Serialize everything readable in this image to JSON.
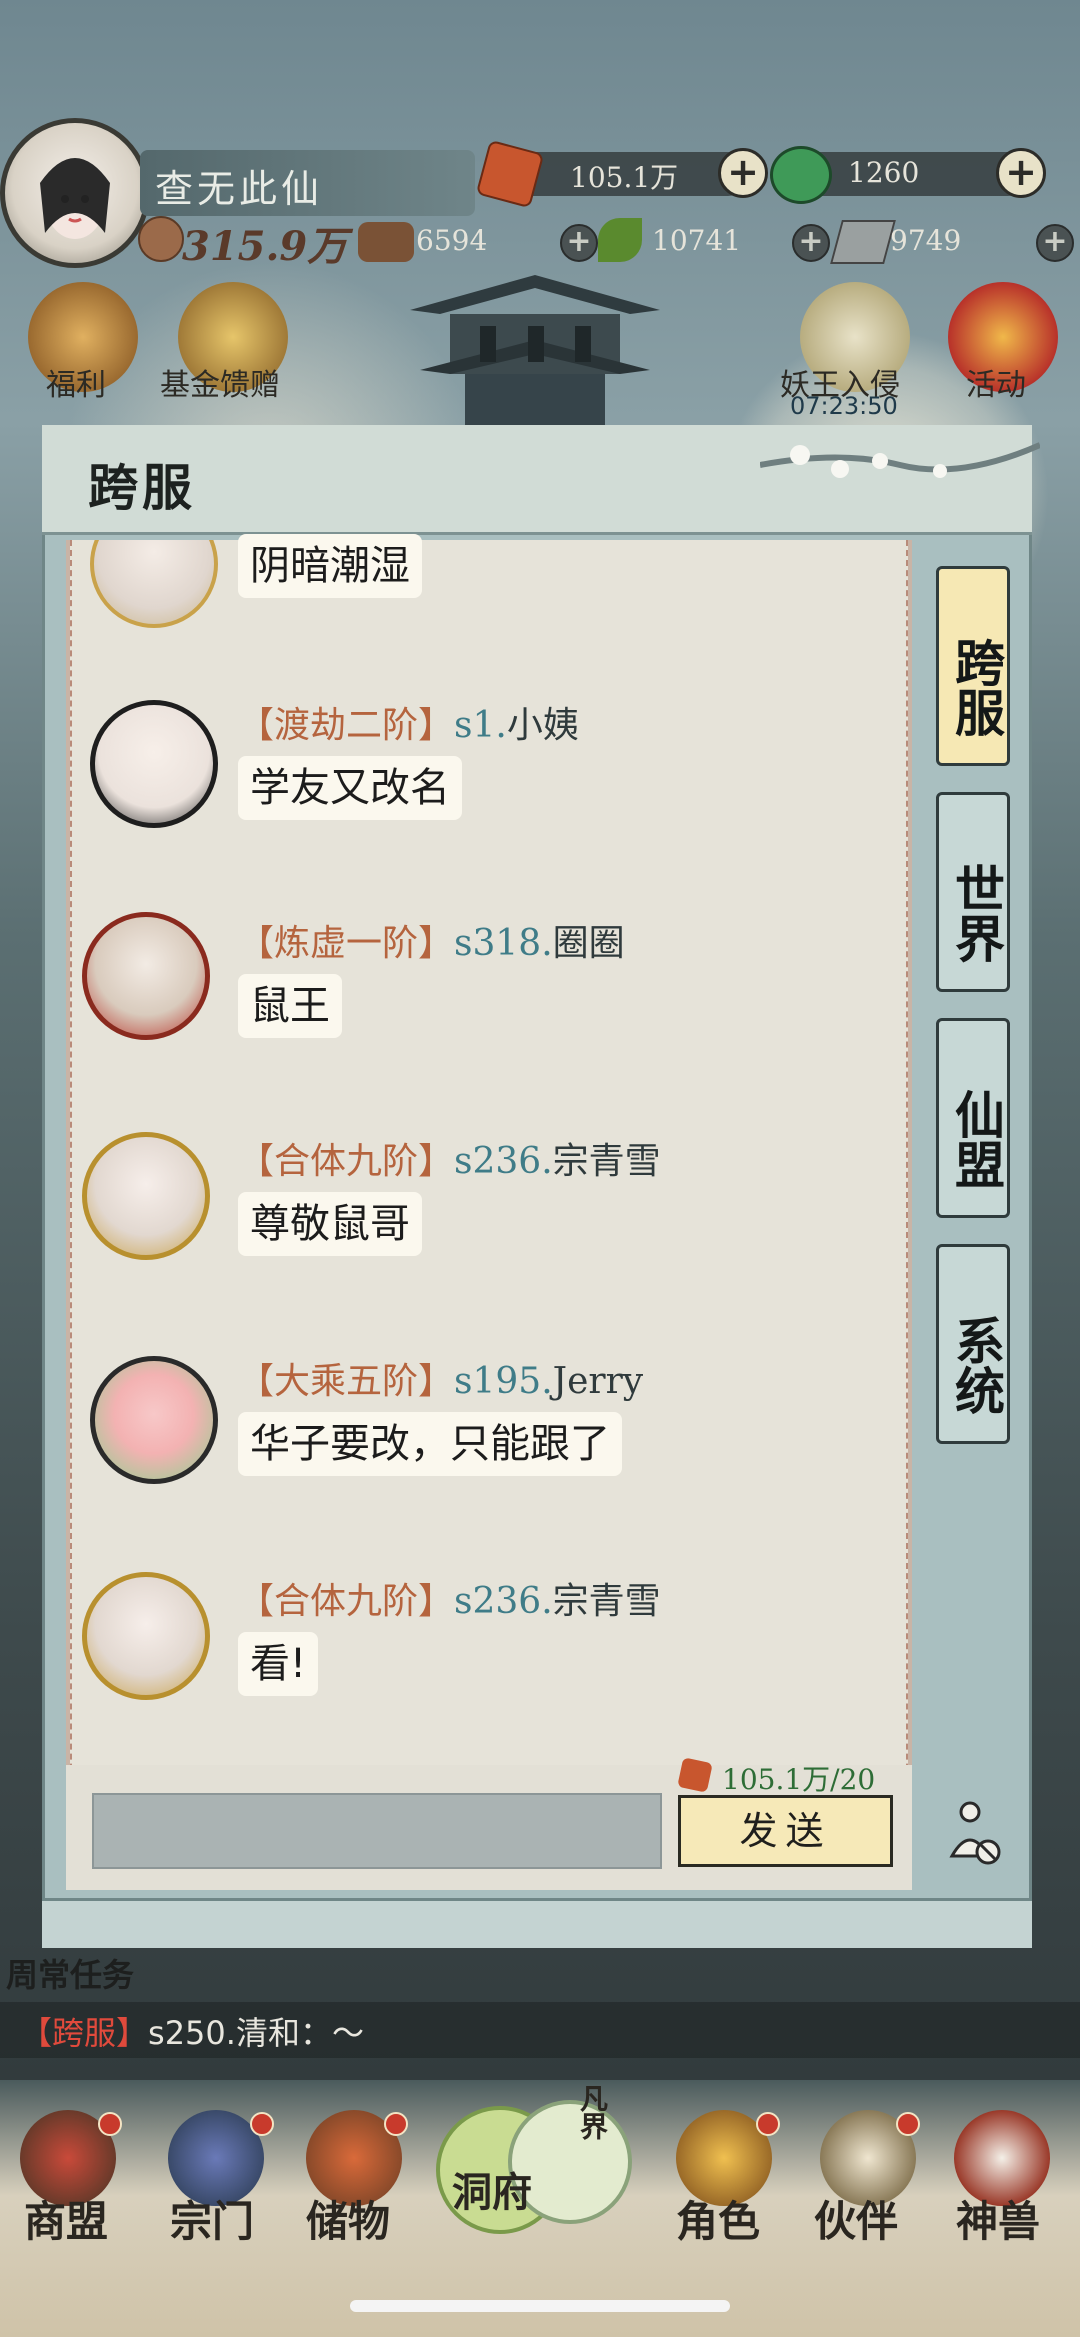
{
  "player": {
    "name": "查无此仙",
    "power": "315.9万"
  },
  "resources": {
    "spirit_stone": "105.1万",
    "jade": "1260",
    "wood": "6594",
    "herb": "10741",
    "iron": "9749"
  },
  "top_buttons": [
    "福利",
    "基金馈赠",
    "妖王入侵",
    "活动"
  ],
  "event_timer": "07:23:50",
  "panel": {
    "title": "跨服",
    "tabs": [
      "跨服",
      "世界",
      "仙盟",
      "系统"
    ],
    "active_tab": "跨服",
    "send_label": "发送",
    "cost": "105.1万/20"
  },
  "messages": [
    {
      "rank": "",
      "server": "",
      "name": "",
      "text": "阴暗潮湿"
    },
    {
      "rank": "【渡劫二阶】",
      "server": "s1.",
      "name": "小姨",
      "text": "学友又改名"
    },
    {
      "rank": "【炼虚一阶】",
      "server": "s318.",
      "name": "圈圈",
      "text": "鼠王"
    },
    {
      "rank": "【合体九阶】",
      "server": "s236.",
      "name": "宗青雪",
      "text": "尊敬鼠哥"
    },
    {
      "rank": "【大乘五阶】",
      "server": "s195.",
      "name": "Jerry",
      "text": "华子要改，只能跟了"
    },
    {
      "rank": "【合体九阶】",
      "server": "s236.",
      "name": "宗青雪",
      "text": "看!"
    }
  ],
  "daily_task": "周常任务",
  "ticker": {
    "channel": "【跨服】",
    "text": "s250.清和：～"
  },
  "nav": [
    "商盟",
    "宗门",
    "储物",
    "洞府",
    "凡界",
    "角色",
    "伙伴",
    "神兽"
  ],
  "colors": {
    "accent": "#f6e8b4",
    "rank": "#b5643e",
    "server": "#3f7c88",
    "alert": "#c83a2c"
  }
}
